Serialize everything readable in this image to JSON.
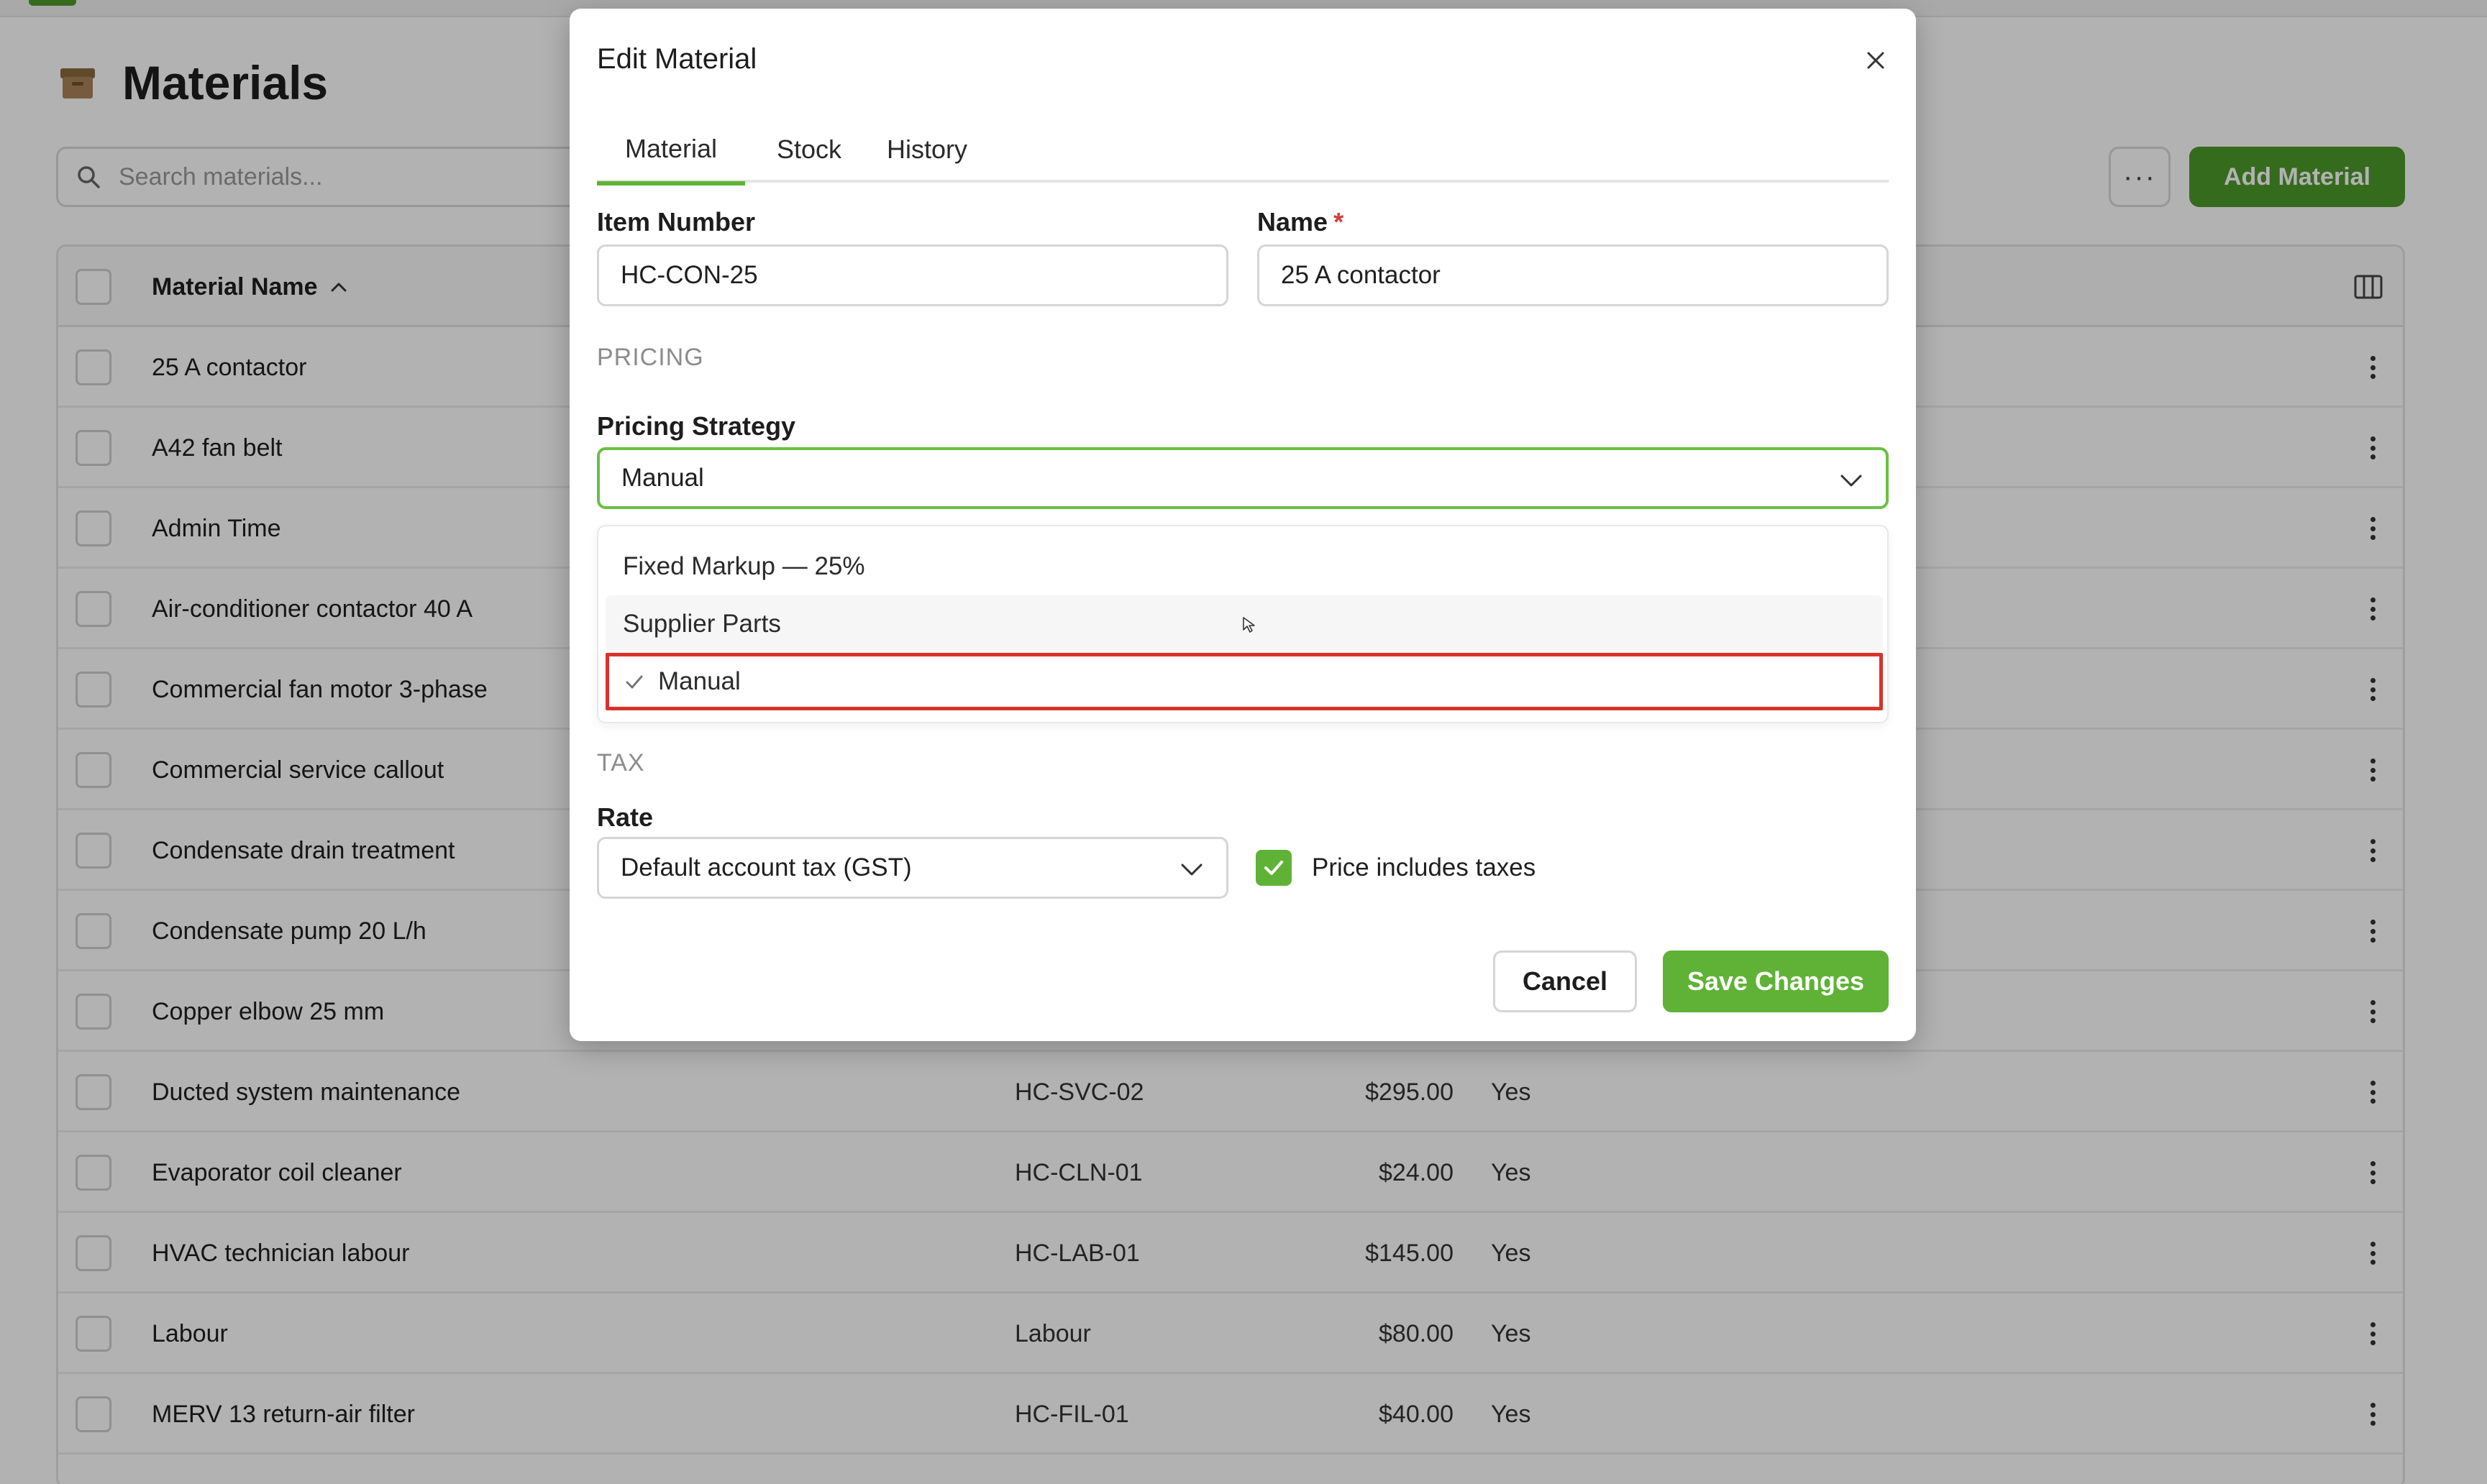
{
  "colors": {
    "accent": "#5fb236",
    "brand_dark": "#4c9a2a",
    "highlight": "#d8322c",
    "required": "#d43b3b"
  },
  "page": {
    "title": "Materials",
    "title_icon": "box-icon",
    "search": {
      "placeholder": "Search materials..."
    },
    "more_label": "···",
    "add_button": "Add Material",
    "table": {
      "name_header": "Material Name",
      "rows": [
        {
          "name": "25 A contactor",
          "number": "",
          "price": "",
          "tax": ""
        },
        {
          "name": "A42 fan belt",
          "number": "",
          "price": "",
          "tax": ""
        },
        {
          "name": "Admin Time",
          "number": "",
          "price": "",
          "tax": ""
        },
        {
          "name": "Air-conditioner contactor 40 A",
          "number": "",
          "price": "",
          "tax": ""
        },
        {
          "name": "Commercial fan motor 3-phase",
          "number": "",
          "price": "",
          "tax": ""
        },
        {
          "name": "Commercial service callout",
          "number": "",
          "price": "",
          "tax": ""
        },
        {
          "name": "Condensate drain treatment",
          "number": "",
          "price": "",
          "tax": ""
        },
        {
          "name": "Condensate pump 20 L/h",
          "number": "",
          "price": "",
          "tax": ""
        },
        {
          "name": "Copper elbow 25 mm",
          "number": "",
          "price": "",
          "tax": ""
        },
        {
          "name": "Ducted system maintenance",
          "number": "HC-SVC-02",
          "price": "$295.00",
          "tax": "Yes"
        },
        {
          "name": "Evaporator coil cleaner",
          "number": "HC-CLN-01",
          "price": "$24.00",
          "tax": "Yes"
        },
        {
          "name": "HVAC technician labour",
          "number": "HC-LAB-01",
          "price": "$145.00",
          "tax": "Yes"
        },
        {
          "name": "Labour",
          "number": "Labour",
          "price": "$80.00",
          "tax": "Yes"
        },
        {
          "name": "MERV 13 return-air filter",
          "number": "HC-FIL-01",
          "price": "$40.00",
          "tax": "Yes"
        }
      ]
    }
  },
  "modal": {
    "title": "Edit Material",
    "tabs": [
      {
        "label": "Material",
        "active": true
      },
      {
        "label": "Stock",
        "active": false
      },
      {
        "label": "History",
        "active": false
      }
    ],
    "item_number": {
      "label": "Item Number",
      "value": "HC-CON-25"
    },
    "name": {
      "label": "Name",
      "required_mark": "*",
      "value": "25 A contactor"
    },
    "pricing_section": "PRICING",
    "pricing_strategy": {
      "label": "Pricing Strategy",
      "value": "Manual",
      "options": [
        "Fixed Markup — 25%",
        "Supplier Parts",
        "Manual"
      ]
    },
    "tax_section": "TAX",
    "rate": {
      "label": "Rate",
      "value": "Default account tax (GST)"
    },
    "price_includes_taxes": {
      "label": "Price includes taxes",
      "checked": true
    },
    "cancel": "Cancel",
    "save": "Save Changes"
  }
}
